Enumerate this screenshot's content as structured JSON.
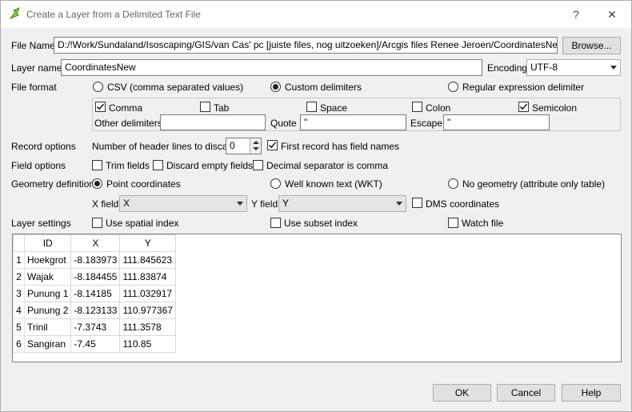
{
  "window": {
    "title": "Create a Layer from a Delimited Text File",
    "help_glyph": "?",
    "close_glyph": "✕"
  },
  "file": {
    "label": "File Name",
    "value": "D:/!Work/Sundaland/Isoscaping/GIS/van Cas' pc [juiste files, nog uitzoeken]/Arcgis files Renee Jeroen/CoordinatesNew.csv",
    "browse_label": "Browse..."
  },
  "layer": {
    "label": "Layer name",
    "value": "CoordinatesNew",
    "encoding_label": "Encoding",
    "encoding_value": "UTF-8"
  },
  "format": {
    "label": "File format",
    "options": [
      {
        "label": "CSV (comma separated values)",
        "selected": false
      },
      {
        "label": "Custom delimiters",
        "selected": true
      },
      {
        "label": "Regular expression delimiter",
        "selected": false
      }
    ],
    "delimiters": [
      {
        "label": "Comma",
        "checked": true
      },
      {
        "label": "Tab",
        "checked": false
      },
      {
        "label": "Space",
        "checked": false
      },
      {
        "label": "Colon",
        "checked": false
      },
      {
        "label": "Semicolon",
        "checked": true
      }
    ],
    "other_label": "Other delimiters",
    "other_value": "",
    "quote_label": "Quote",
    "quote_value": "\"",
    "escape_label": "Escape",
    "escape_value": "\""
  },
  "record": {
    "label": "Record options",
    "header_lines_label": "Number of header lines to discard",
    "header_lines_value": "0",
    "first_record_label": "First record has field names",
    "first_record_checked": true
  },
  "field": {
    "label": "Field options",
    "trim_label": "Trim fields",
    "discard_label": "Discard empty fields",
    "decimal_label": "Decimal separator is comma"
  },
  "geometry": {
    "label": "Geometry definition",
    "options": [
      {
        "label": "Point coordinates",
        "selected": true
      },
      {
        "label": "Well known text (WKT)",
        "selected": false
      },
      {
        "label": "No geometry (attribute only table)",
        "selected": false
      }
    ],
    "x_label": "X field",
    "x_value": "X",
    "y_label": "Y field",
    "y_value": "Y",
    "dms_label": "DMS coordinates"
  },
  "settings": {
    "label": "Layer settings",
    "spatial_label": "Use spatial index",
    "subset_label": "Use subset index",
    "watch_label": "Watch file"
  },
  "table": {
    "columns": [
      "ID",
      "X",
      "Y"
    ],
    "rows": [
      {
        "n": "1",
        "cells": [
          "Hoekgrot",
          "-8.183973",
          "111.845623"
        ]
      },
      {
        "n": "2",
        "cells": [
          "Wajak",
          "-8.184455",
          "111.83874"
        ]
      },
      {
        "n": "3",
        "cells": [
          "Punung 1",
          "-8.14185",
          "111.032917"
        ]
      },
      {
        "n": "4",
        "cells": [
          "Punung 2",
          "-8.123133",
          "110.977367"
        ]
      },
      {
        "n": "5",
        "cells": [
          "Trinil",
          "-7.3743",
          "111.3578"
        ]
      },
      {
        "n": "6",
        "cells": [
          "Sangiran",
          "-7.45",
          "110.85"
        ]
      }
    ]
  },
  "buttons": {
    "ok": "OK",
    "cancel": "Cancel",
    "help": "Help"
  }
}
